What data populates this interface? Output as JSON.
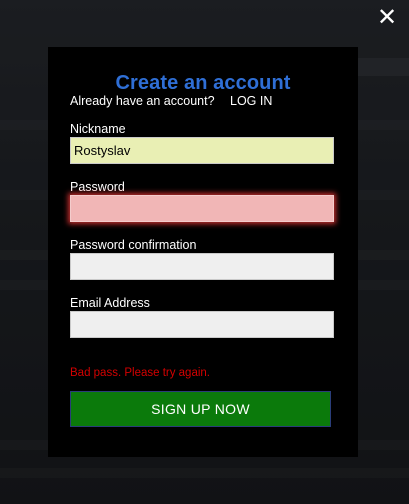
{
  "modal": {
    "title": "Create an account",
    "have_account_text": "Already have an account?",
    "login_link": "LOG IN",
    "close_icon": "close-icon"
  },
  "fields": {
    "nickname": {
      "label": "Nickname",
      "value": "Rostyslav"
    },
    "password": {
      "label": "Password",
      "value": ""
    },
    "password_confirmation": {
      "label": "Password confirmation",
      "value": ""
    },
    "email": {
      "label": "Email Address",
      "value": ""
    }
  },
  "error_message": "Bad pass. Please try again.",
  "signup_button": "SIGN UP NOW",
  "colors": {
    "title": "#2f6fd6",
    "nickname_bg": "#e9efb4",
    "password_error_bg": "#f1b6b6",
    "error_text": "#d40000",
    "signup_bg": "#0b7a0b"
  }
}
